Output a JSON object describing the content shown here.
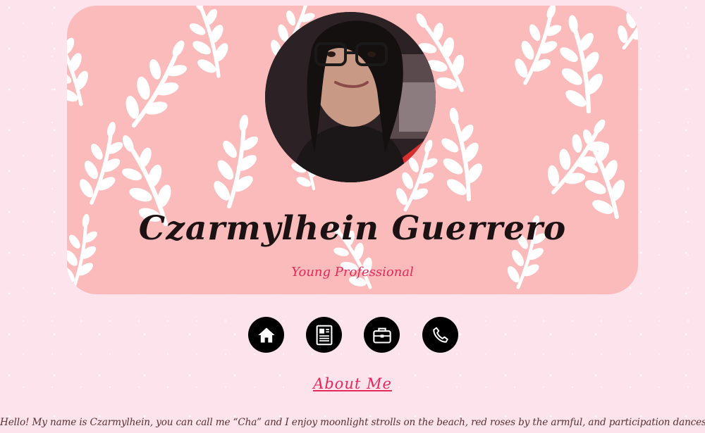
{
  "profile": {
    "name": "Czarmylhein Guerrero",
    "role": "Young Professional"
  },
  "nav": {
    "items": [
      {
        "icon": "home-icon"
      },
      {
        "icon": "resume-icon"
      },
      {
        "icon": "briefcase-icon"
      },
      {
        "icon": "phone-icon"
      }
    ]
  },
  "about": {
    "heading": "About Me",
    "bio": "Hello! My name is Czarmylhein, you can call me “Cha” and I enjoy moonlight strolls on the beach, red roses by the armful, and participation dances."
  },
  "colors": {
    "page_background": "#fde3ec",
    "banner_background": "#fbbbbb",
    "accent": "#e6285a",
    "icon_background": "#000000"
  }
}
